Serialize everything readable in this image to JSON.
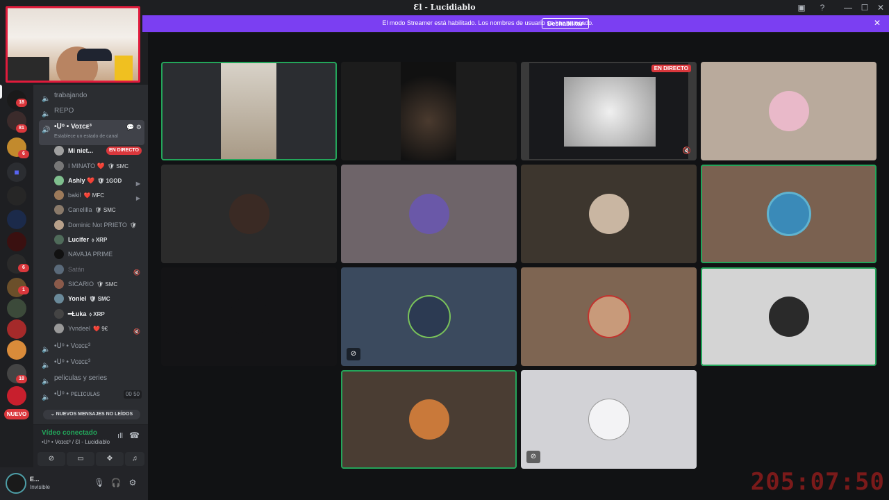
{
  "window": {
    "title": "Ɛl - Ⅼucidiablo",
    "minimize": "—",
    "maximize": "☐",
    "close": "✕"
  },
  "banner": {
    "text": "El modo Streamer está habilitado. Los nombres de usuario se han truncado.",
    "button": "Deshabilitar"
  },
  "guilds": {
    "badges": [
      "18",
      "81",
      "6",
      "6",
      "1",
      "18"
    ],
    "nuevo": "NUEVO"
  },
  "channels": [
    {
      "name": "trabajando"
    },
    {
      "name": "REPO"
    },
    {
      "name": "•ᑌᵒ • Voɪᴄᴇ³",
      "status": "Establece un estado de canal"
    }
  ],
  "members": [
    {
      "name": "Mi niet...",
      "live": "EN DIRECTO"
    },
    {
      "name": "I MINATO ❤️",
      "tag": "🛡 SMC"
    },
    {
      "name": "Ashly ❤️",
      "tag": "🛡 1GOD"
    },
    {
      "name": "bakil",
      "tag": "❤️ MFC"
    },
    {
      "name": "Canelilla",
      "tag": "🛡 SMC"
    },
    {
      "name": "Dominic Not PRIETO",
      "tag": "🛡"
    },
    {
      "name": "Lucifer",
      "tag": "⬨ XRP"
    },
    {
      "name": "NAVAJA PRIME",
      "tag": ""
    },
    {
      "name": "Satán",
      "tag": ""
    },
    {
      "name": "SICARIO",
      "tag": "🛡 SMC"
    },
    {
      "name": "Yoniel",
      "tag": "🛡 SMC"
    },
    {
      "name": "━Ƚuka",
      "tag": "⬨ XRP"
    },
    {
      "name": "Yvndeel",
      "tag": "❤️ 9€"
    }
  ],
  "more_channels": [
    {
      "name": "•ᑌᵒ • Voɪᴄᴇ³"
    },
    {
      "name": "•ᑌᵒ • Voɪᴄᴇ³"
    },
    {
      "name": "peliculas y series"
    },
    {
      "name": "•ᑌᵒ • ᴘᴇʟɪᴄᴜʟᴀs",
      "count": "00 50"
    }
  ],
  "unread": "NUEVOS MENSAJES NO LEÍDOS",
  "voice": {
    "status": "Vídeo conectado",
    "channel": "•ᑌᵒ • Voɪᴄᴇ³ / Ɛl - Ⅼucidiablo"
  },
  "user": {
    "name": "E...",
    "status": "Invisible"
  },
  "stream": {
    "live": "EN DIRECTO"
  },
  "timer": "205:07:50",
  "colors": {
    "banner": "#7b3ff2",
    "live": "#da373c",
    "speaking": "#23a55a",
    "timer": "#7a1a1a"
  }
}
